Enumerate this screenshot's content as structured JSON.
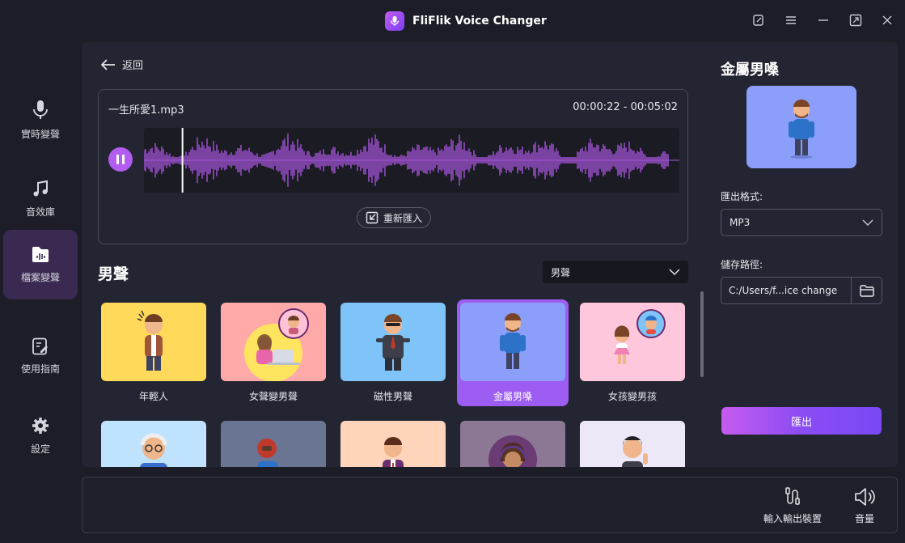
{
  "app": {
    "title": "FliFlik Voice Changer"
  },
  "sidebar": {
    "items": [
      {
        "label": "實時變聲",
        "icon": "microphone-icon"
      },
      {
        "label": "音效庫",
        "icon": "music-note-icon"
      },
      {
        "label": "檔案變聲",
        "icon": "audio-file-icon",
        "active": true
      },
      {
        "label": "使用指南",
        "icon": "guide-icon"
      },
      {
        "label": "設定",
        "icon": "gear-icon"
      }
    ]
  },
  "main": {
    "back_label": "返回",
    "player": {
      "file_name": "一生所愛1.mp3",
      "time": "00:00:22 - 00:05:02",
      "progress": 0.072,
      "reimport_label": "重新匯入"
    },
    "section_title": "男聲",
    "filter_value": "男聲",
    "voices": [
      {
        "label": "年輕人",
        "bg": "#ffd95a"
      },
      {
        "label": "女聲變男聲",
        "bg": "#ffaaa8"
      },
      {
        "label": "磁性男聲",
        "bg": "#7fc4f9"
      },
      {
        "label": "金屬男嗓",
        "bg": "#8b9ef9",
        "active": true
      },
      {
        "label": "女孩變男孩",
        "bg": "#ffc7dc"
      }
    ],
    "voices_row2_bg": [
      "#bfe2ff",
      "#6a7593",
      "#ffd4bb",
      "#8c7894",
      "#ece8f8"
    ]
  },
  "right_panel": {
    "title": "金屬男嗓",
    "format_label": "匯出格式:",
    "format_value": "MP3",
    "path_label": "儲存路徑:",
    "path_value": "C:/Users/f...ice change",
    "export_label": "匯出"
  },
  "bottom_bar": {
    "io_label": "輸入輸出裝置",
    "volume_label": "音量"
  },
  "colors": {
    "accent": "#b25cf0",
    "waveform": "#a454d8"
  }
}
